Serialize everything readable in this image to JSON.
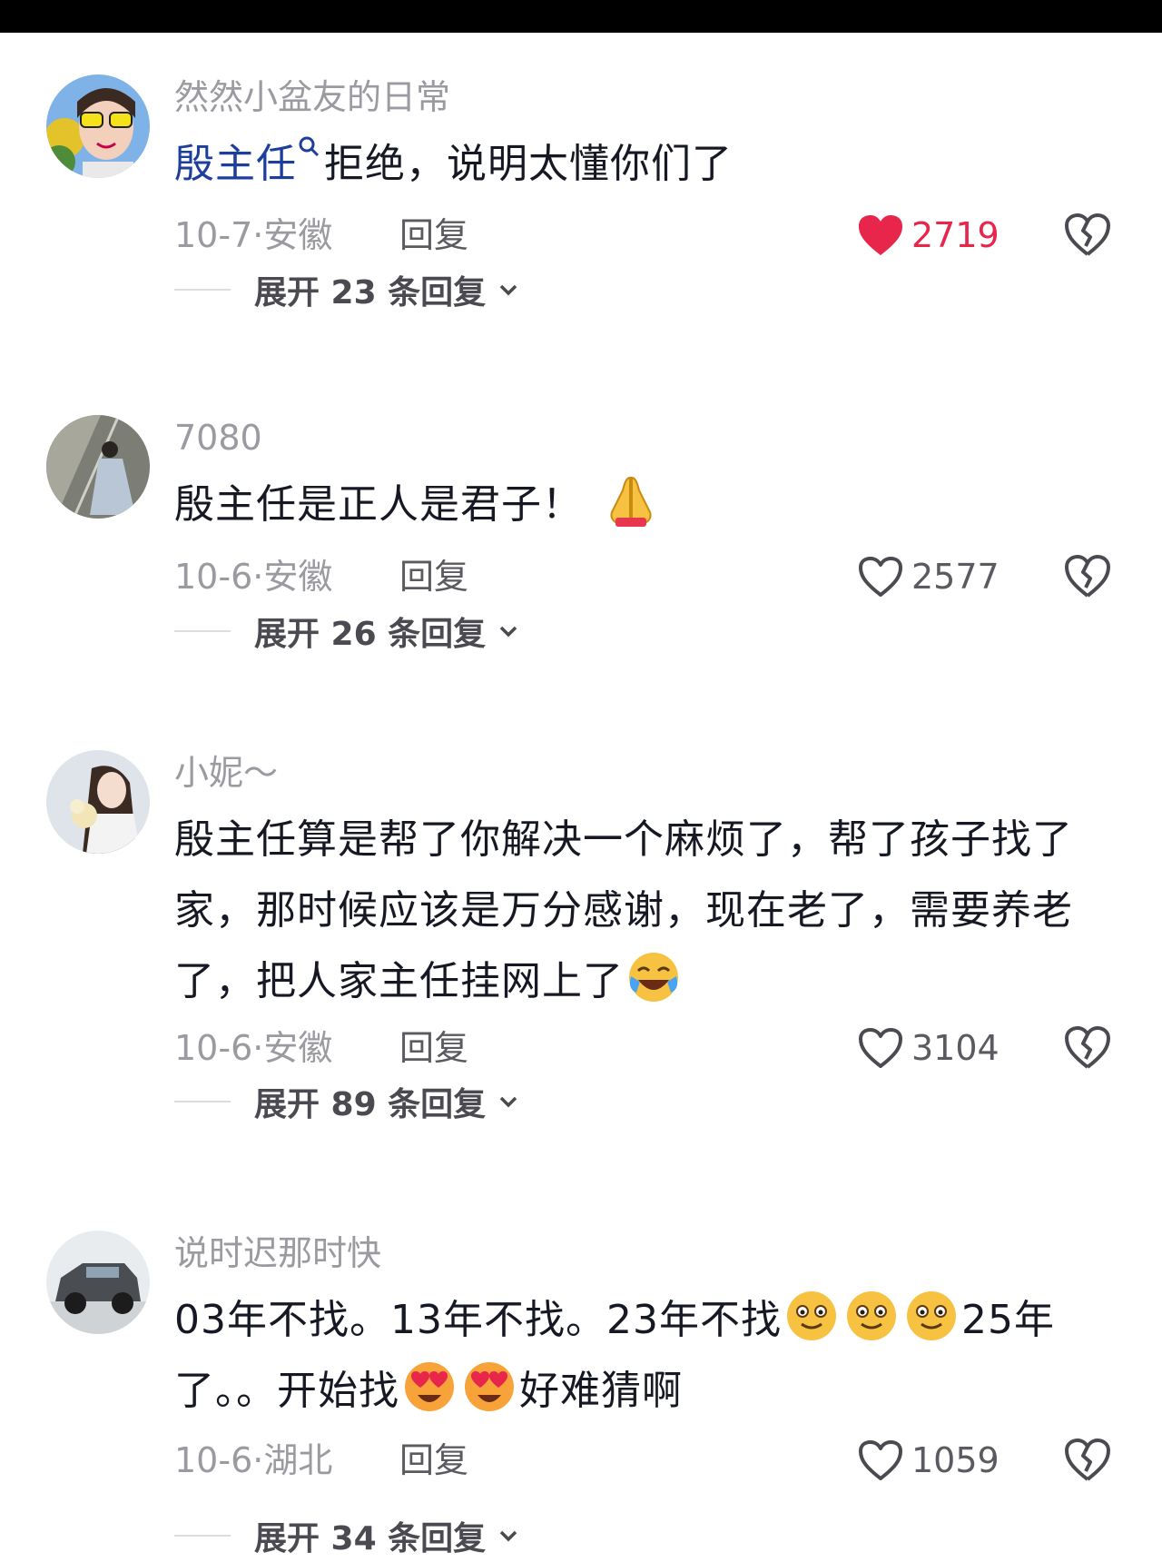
{
  "comments": [
    {
      "username": "然然小盆友的日常",
      "mention": "殷主任",
      "text": "拒绝，说明太懂你们了",
      "date": "10-7",
      "location": "安徽",
      "reply_label": "回复",
      "likes": "2719",
      "liked": true,
      "expand_label": "展开 23 条回复"
    },
    {
      "username": "7080",
      "text": "殷主任是正人是君子！",
      "emoji": "folded-hands",
      "date": "10-6",
      "location": "安徽",
      "reply_label": "回复",
      "likes": "2577",
      "liked": false,
      "expand_label": "展开 26 条回复"
    },
    {
      "username": "小妮～",
      "text_lines": [
        "殷主任算是帮了你解决一个麻烦了，帮了孩子找了",
        "家，那时候应该是万分感谢，现在老了，需要养老",
        "了，把人家主任挂网上了"
      ],
      "emoji": "laughing-crying",
      "date": "10-6",
      "location": "安徽",
      "reply_label": "回复",
      "likes": "3104",
      "liked": false,
      "expand_label": "展开 89 条回复"
    },
    {
      "username": "说时迟那时快",
      "text_segments": [
        "03年不找。13年不找。23年不找",
        "25年",
        "了。。开始找",
        "好难猜啊"
      ],
      "emojis": [
        "grinning-face",
        "heart-eyes-face"
      ],
      "date": "10-6",
      "location": "湖北",
      "reply_label": "回复",
      "likes": "1059",
      "liked": false,
      "expand_label": "展开 34 条回复"
    }
  ],
  "colors": {
    "like_red": "#e8254b",
    "mention_blue": "#1e3e9c",
    "meta_gray": "#9a9aa0"
  }
}
